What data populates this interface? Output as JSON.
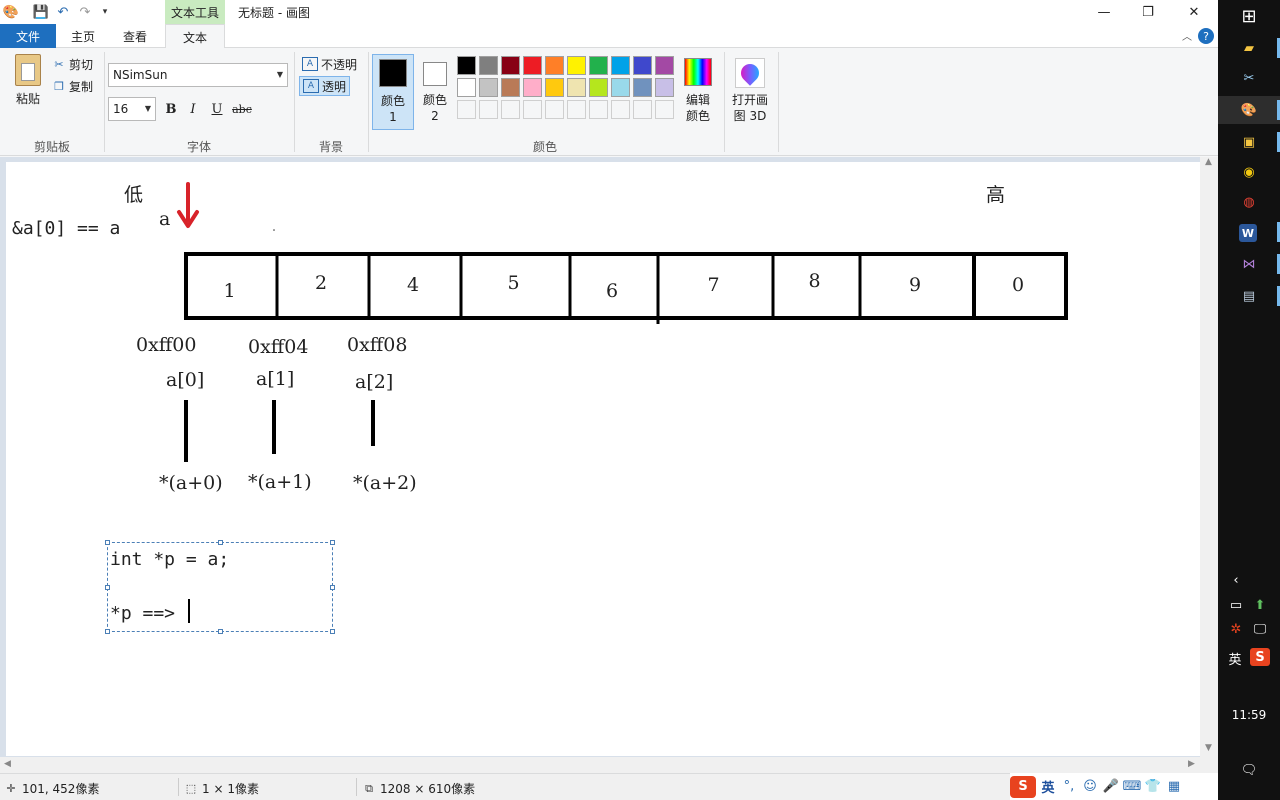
{
  "window": {
    "title": "无标题 - 画图",
    "context_tab": "文本工具"
  },
  "tabs": {
    "file": "文件",
    "home": "主页",
    "view": "查看",
    "text": "文本"
  },
  "clipboard": {
    "paste": "粘贴",
    "cut": "剪切",
    "copy": "复制",
    "group": "剪贴板"
  },
  "font": {
    "family": "NSimSun",
    "size": "16",
    "bold": "B",
    "italic": "I",
    "underline": "U",
    "strike": "abc",
    "group": "字体"
  },
  "background": {
    "opaque": "不透明",
    "transparent": "透明",
    "group": "背景"
  },
  "colors": {
    "color1": "颜色 1",
    "color2": "颜色 2",
    "color1_value": "#000000",
    "color2_value": "#ffffff",
    "edit": "编辑颜色",
    "group": "颜色",
    "palette_row1": [
      "#000000",
      "#7f7f7f",
      "#880015",
      "#ed1c24",
      "#ff7f27",
      "#fff200",
      "#22b14c",
      "#00a2e8",
      "#3f48cc",
      "#a349a4"
    ],
    "palette_row2": [
      "#ffffff",
      "#c3c3c3",
      "#b97a57",
      "#ffaec9",
      "#ffc90e",
      "#efe4b0",
      "#b5e61d",
      "#99d9ea",
      "#7092be",
      "#c8bfe7"
    ]
  },
  "paint3d": "打开画图 3D",
  "canvas": {
    "low_label": "低",
    "high_label": "高",
    "addr_eq": "&a[0] == a",
    "arrow_label": "a",
    "array_values": [
      "1",
      "2",
      "4",
      "5",
      "6",
      "7",
      "8",
      "9",
      "0"
    ],
    "addresses": [
      "0xff00",
      "0xff04",
      "0xff08"
    ],
    "elements": [
      "a[0]",
      "a[1]",
      "a[2]"
    ],
    "derefs": [
      "*(a+0)",
      "*(a+1)",
      "*(a+2)"
    ],
    "code_line1": "int *p = a;",
    "code_line2": "*p ==>"
  },
  "status": {
    "cursor_pos": "101, 452像素",
    "selection_size": "1 × 1像素",
    "canvas_size": "1208 × 610像素"
  },
  "ime": {
    "lang": "英"
  },
  "taskbar": {
    "tray_lang": "英",
    "clock": "11:59"
  }
}
